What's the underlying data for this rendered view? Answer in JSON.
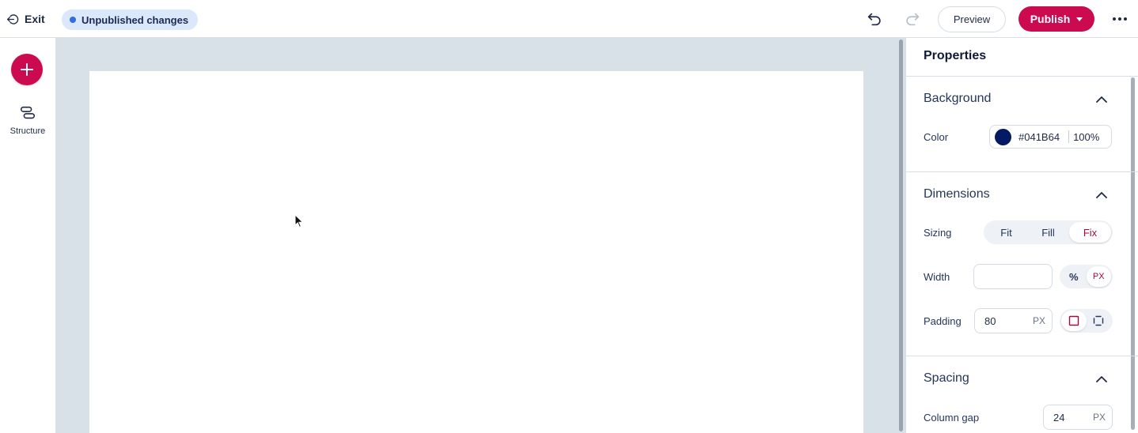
{
  "topbar": {
    "exit_label": "Exit",
    "status_badge": "Unpublished changes",
    "preview_label": "Preview",
    "publish_label": "Publish"
  },
  "rail": {
    "structure_label": "Structure"
  },
  "properties": {
    "title": "Properties",
    "background": {
      "title": "Background",
      "color_label": "Color",
      "color_value": "#041B64",
      "opacity": "100%"
    },
    "dimensions": {
      "title": "Dimensions",
      "sizing_label": "Sizing",
      "sizing_options": [
        "Fit",
        "Fill",
        "Fix"
      ],
      "sizing_selected": "Fix",
      "width_label": "Width",
      "width_value": "",
      "width_unit_percent": "%",
      "width_unit_px": "PX",
      "width_unit_selected": "PX",
      "padding_label": "Padding",
      "padding_value": "80",
      "padding_unit": "PX"
    },
    "spacing": {
      "title": "Spacing",
      "column_gap_label": "Column gap",
      "column_gap_value": "24",
      "column_gap_unit": "PX"
    }
  },
  "colors": {
    "brand": "#CC0A4F",
    "canvas_bg": "#D8E0E8",
    "badge_bg": "#DBE7FB",
    "badge_dot": "#2F6FE0"
  }
}
